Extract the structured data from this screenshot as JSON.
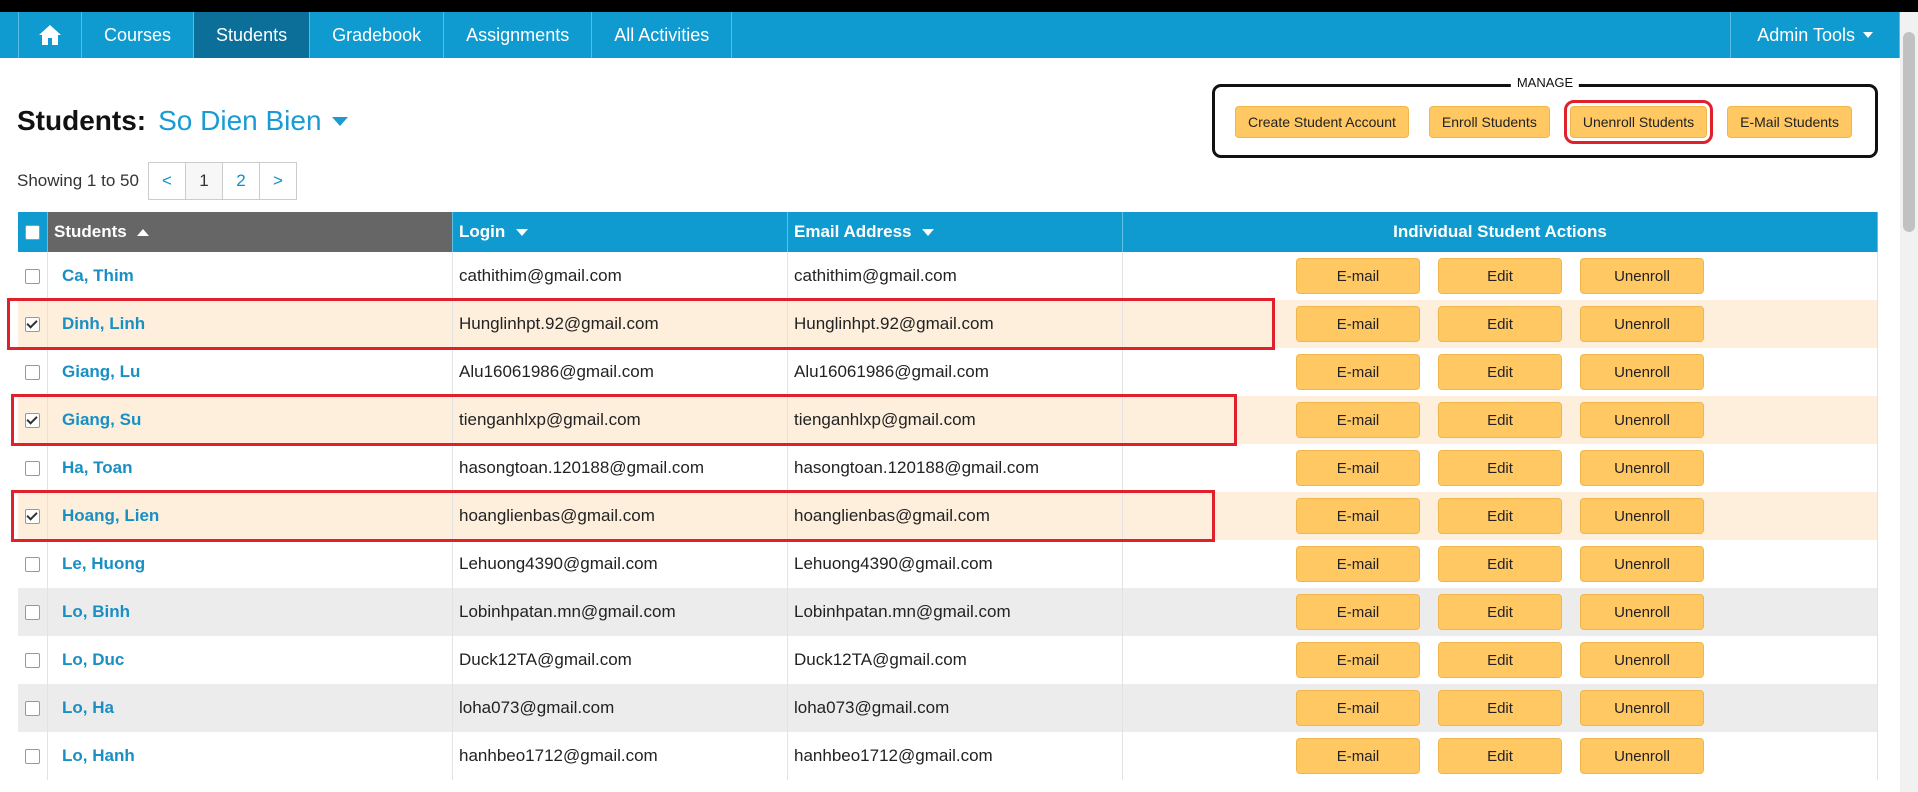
{
  "nav": {
    "home_icon": "home-icon",
    "items": [
      "Courses",
      "Students",
      "Gradebook",
      "Assignments",
      "All Activities"
    ],
    "active": "Students",
    "admin": "Admin Tools"
  },
  "page": {
    "title_label": "Students:",
    "class_name": "So Dien Bien"
  },
  "manage": {
    "legend": "MANAGE",
    "buttons": [
      "Create Student Account",
      "Enroll Students",
      "Unenroll Students",
      "E-Mail Students"
    ]
  },
  "pager": {
    "text": "Showing 1 to 50",
    "prev": "<",
    "pages": [
      "1",
      "2"
    ],
    "next": ">"
  },
  "table": {
    "headers": {
      "students": "Students",
      "login": "Login",
      "email": "Email Address",
      "actions": "Individual Student Actions"
    },
    "action_labels": [
      "E-mail",
      "Edit",
      "Unenroll"
    ],
    "rows": [
      {
        "name": "Ca, Thim",
        "login": "cathithim@gmail.com",
        "email": "cathithim@gmail.com",
        "checked": false
      },
      {
        "name": "Dinh, Linh",
        "login": "Hunglinhpt.92@gmail.com",
        "email": "Hunglinhpt.92@gmail.com",
        "checked": true
      },
      {
        "name": "Giang, Lu",
        "login": "Alu16061986@gmail.com",
        "email": "Alu16061986@gmail.com",
        "checked": false
      },
      {
        "name": "Giang, Su",
        "login": "tienganhlxp@gmail.com",
        "email": "tienganhlxp@gmail.com",
        "checked": true
      },
      {
        "name": "Ha, Toan",
        "login": "hasongtoan.120188@gmail.com",
        "email": "hasongtoan.120188@gmail.com",
        "checked": false
      },
      {
        "name": "Hoang, Lien",
        "login": "hoanglienbas@gmail.com",
        "email": "hoanglienbas@gmail.com",
        "checked": true
      },
      {
        "name": "Le, Huong",
        "login": "Lehuong4390@gmail.com",
        "email": "Lehuong4390@gmail.com",
        "checked": false
      },
      {
        "name": "Lo, Binh",
        "login": "Lobinhpatan.mn@gmail.com",
        "email": "Lobinhpatan.mn@gmail.com",
        "checked": false
      },
      {
        "name": "Lo, Duc",
        "login": "Duck12TA@gmail.com",
        "email": "Duck12TA@gmail.com",
        "checked": false
      },
      {
        "name": "Lo, Ha",
        "login": "loha073@gmail.com",
        "email": "loha073@gmail.com",
        "checked": false
      },
      {
        "name": "Lo, Hanh",
        "login": "hanhbeo1712@gmail.com",
        "email": "hanhbeo1712@gmail.com",
        "checked": false
      }
    ]
  },
  "colors": {
    "nav": "#0f9bd0",
    "button": "#ffc862",
    "link": "#1a8fc4",
    "highlight": "#e0202a",
    "selected_row": "#fdefdc"
  }
}
